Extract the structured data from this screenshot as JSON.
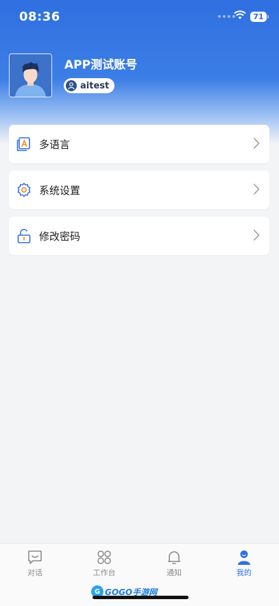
{
  "status_bar": {
    "time": "08:36",
    "battery": "71"
  },
  "profile": {
    "name": "APP测试账号",
    "username": "aitest"
  },
  "menu": [
    {
      "label": "多语言",
      "icon": "language-icon"
    },
    {
      "label": "系统设置",
      "icon": "settings-gear-icon"
    },
    {
      "label": "修改密码",
      "icon": "unlock-icon"
    }
  ],
  "tabs": [
    {
      "label": "对话",
      "icon": "chat-icon",
      "active": false
    },
    {
      "label": "工作台",
      "icon": "workbench-icon",
      "active": false
    },
    {
      "label": "通知",
      "icon": "bell-icon",
      "active": false
    },
    {
      "label": "我的",
      "icon": "profile-icon",
      "active": true
    }
  ],
  "watermark": {
    "brand": "GOGO手游网"
  },
  "colors": {
    "primary": "#2f6fe0",
    "background": "#f3f4f6",
    "inactive": "#8a8a8e"
  }
}
